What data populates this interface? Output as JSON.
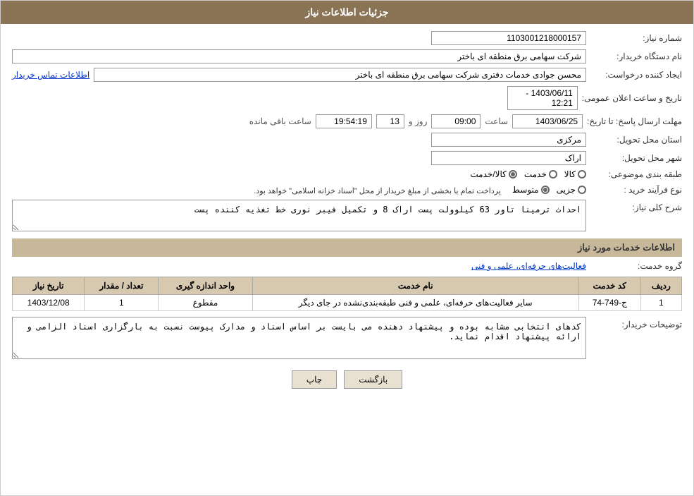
{
  "header": {
    "title": "جزئیات اطلاعات نیاز"
  },
  "fields": {
    "request_number_label": "شماره نیاز:",
    "request_number_value": "1103001218000157",
    "buyer_org_label": "نام دستگاه خریدار:",
    "buyer_org_value": "شرکت سهامی برق منطقه ای باختر",
    "creator_label": "ایجاد کننده درخواست:",
    "creator_value": "محسن جوادی خدمات دفتری شرکت سهامی برق منطقه ای باختر",
    "creator_link": "اطلاعات تماس خریدار",
    "announce_date_label": "تاریخ و ساعت اعلان عمومی:",
    "announce_date_value": "1403/06/11 - 12:21",
    "response_date_label": "مهلت ارسال پاسخ: تا تاریخ:",
    "response_date": "1403/06/25",
    "response_time_label": "ساعت",
    "response_time": "09:00",
    "response_days_label": "روز و",
    "response_days": "13",
    "remaining_label": "ساعت باقی مانده",
    "remaining_time": "19:54:19",
    "province_label": "استان محل تحویل:",
    "province_value": "مرکزی",
    "city_label": "شهر محل تحویل:",
    "city_value": "اراک",
    "category_label": "طبقه بندی موضوعی:",
    "category_kala": "کالا",
    "category_khedmat": "خدمت",
    "category_kala_khedmat": "کالا/خدمت",
    "category_selected": "kala_khedmat",
    "purchase_type_label": "نوع فرآیند خرید :",
    "purchase_jozii": "جزیی",
    "purchase_motavasset": "متوسط",
    "purchase_note": "پرداخت تمام یا بخشی از مبلغ خریدار از محل \"اسناد خزانه اسلامی\" خواهد بود.",
    "description_label": "شرح کلی نیاز:",
    "description_value": "احداث ترمینا تاور 63 کیلوولت پست اراک 8 و تکمیل فیبر نوری خط تغذیه کننده پست",
    "service_info_title": "اطلاعات خدمات مورد نیاز",
    "service_group_label": "گروه خدمت:",
    "service_group_value": "فعالیت‌های حرفه‌ای، علمی و فنی",
    "table_columns": {
      "row_num": "ردیف",
      "service_code": "کد خدمت",
      "service_name": "نام خدمت",
      "unit": "واحد اندازه گیری",
      "quantity": "تعداد / مقدار",
      "date": "تاریخ نیاز"
    },
    "table_rows": [
      {
        "row_num": "1",
        "service_code": "ج-749-74",
        "service_name": "سایر فعالیت‌های حرفه‌ای، علمی و فنی طبقه‌بندی‌نشده در جای دیگر",
        "unit": "مقطوع",
        "quantity": "1",
        "date": "1403/12/08"
      }
    ],
    "buyer_notes_label": "توضیحات خریدار:",
    "buyer_notes_value": "کدهای انتخابی مشابه بوده و پیشنهاد دهنده می بایست بر اساس اسناد و مدارک پیوست نسبت به بارگزاری اسناد الزامی و ارائه پیشنهاد اقدام نماید.",
    "btn_print": "چاپ",
    "btn_back": "بازگشت"
  }
}
